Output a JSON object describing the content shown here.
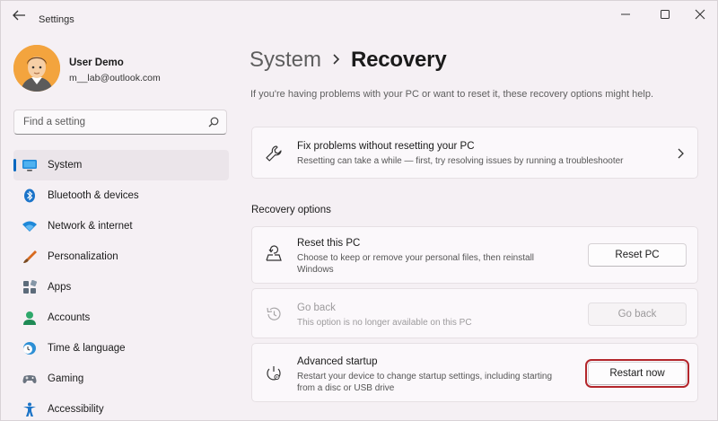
{
  "window": {
    "title": "Settings"
  },
  "profile": {
    "name": "User Demo",
    "email": "m__lab@outlook.com"
  },
  "search": {
    "placeholder": "Find a setting"
  },
  "nav": {
    "items": [
      {
        "label": "System",
        "icon": "system-icon",
        "active": true
      },
      {
        "label": "Bluetooth & devices",
        "icon": "bluetooth-icon"
      },
      {
        "label": "Network & internet",
        "icon": "wifi-icon"
      },
      {
        "label": "Personalization",
        "icon": "brush-icon"
      },
      {
        "label": "Apps",
        "icon": "apps-icon"
      },
      {
        "label": "Accounts",
        "icon": "accounts-icon"
      },
      {
        "label": "Time & language",
        "icon": "clock-globe-icon"
      },
      {
        "label": "Gaming",
        "icon": "gamepad-icon"
      },
      {
        "label": "Accessibility",
        "icon": "accessibility-icon"
      }
    ]
  },
  "main": {
    "breadcrumb_parent": "System",
    "breadcrumb_current": "Recovery",
    "description": "If you're having problems with your PC or want to reset it, these recovery options might help.",
    "fix_card": {
      "title": "Fix problems without resetting your PC",
      "subtitle": "Resetting can take a while — first, try resolving issues by running a troubleshooter"
    },
    "section_label": "Recovery options",
    "reset_card": {
      "title": "Reset this PC",
      "subtitle_line1": "Choose to keep or remove your personal files, then reinstall",
      "subtitle_line2": "Windows",
      "button": "Reset PC"
    },
    "goback_card": {
      "title": "Go back",
      "subtitle": "This option is no longer available on this PC",
      "button": "Go back"
    },
    "advanced_card": {
      "title": "Advanced startup",
      "subtitle_line1": "Restart your device to change startup settings, including starting",
      "subtitle_line2": "from a disc or USB drive",
      "button": "Restart now"
    }
  },
  "colors": {
    "accent": "#0067c0",
    "highlight_outline": "#b3262b"
  }
}
